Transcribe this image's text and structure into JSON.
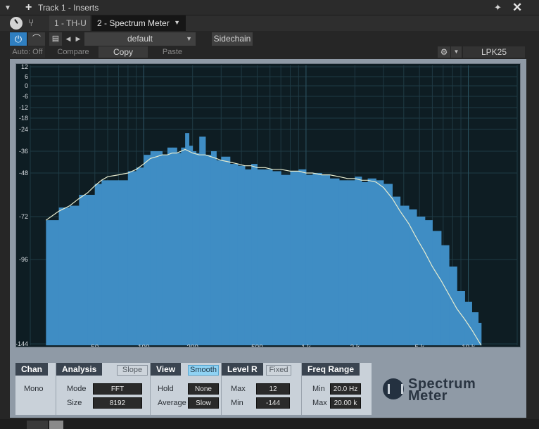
{
  "window": {
    "title": "Track 1 - Inserts"
  },
  "tabs": [
    {
      "label": "1 - TH-U"
    },
    {
      "label": "2 - Spectrum Meter"
    }
  ],
  "presets": {
    "name": "default",
    "sidechain_label": "Sidechain"
  },
  "toolbar": {
    "auto_label": "Auto: Off",
    "compare_label": "Compare",
    "copy_label": "Copy",
    "paste_label": "Paste",
    "device_label": "LPK25"
  },
  "chart_data": {
    "type": "area",
    "ytick_labels": [
      "12",
      "6",
      "0",
      "-6",
      "-12",
      "-18",
      "-24",
      "-36",
      "-48",
      "-72",
      "-96",
      "-144"
    ],
    "xtick_labels": [
      "50",
      "100",
      "200",
      "500",
      "1 k",
      "2 k",
      "5 k",
      "10 k"
    ],
    "xticks": [
      50,
      100,
      200,
      500,
      1000,
      2000,
      5000,
      10000
    ],
    "xlim": [
      20,
      20000
    ],
    "x_scale": "log",
    "y_scale": "nonlinear (dB meter)",
    "grid": true,
    "series": [
      {
        "style": "filled-bars",
        "color": "#3f8dc4",
        "x": [
          25,
          30,
          35,
          40,
          45,
          50,
          55,
          60,
          70,
          80,
          90,
          100,
          110,
          120,
          130,
          140,
          150,
          160,
          170,
          180,
          190,
          200,
          210,
          220,
          240,
          260,
          280,
          300,
          340,
          380,
          420,
          460,
          500,
          560,
          620,
          700,
          800,
          900,
          1000,
          1100,
          1250,
          1400,
          1600,
          1800,
          2000,
          2200,
          2400,
          2700,
          3000,
          3400,
          3800,
          4300,
          4800,
          5400,
          6000,
          6800,
          7600,
          8500,
          9500,
          10500,
          11500,
          12000
        ],
        "values": [
          -74,
          -67,
          -66,
          -60,
          -60,
          -54,
          -52,
          -52,
          -52,
          -47,
          -45,
          -38,
          -36,
          -36,
          -38,
          -34,
          -34,
          -37,
          -34,
          -26,
          -33,
          -36,
          -37,
          -28,
          -38,
          -36,
          -41,
          -39,
          -43,
          -44,
          -46,
          -43,
          -46,
          -46,
          -47,
          -49,
          -47,
          -46,
          -49,
          -48,
          -49,
          -51,
          -52,
          -52,
          -50,
          -53,
          -51,
          -52,
          -54,
          -61,
          -66,
          -68,
          -72,
          -74,
          -80,
          -88,
          -100,
          -114,
          -120,
          -126,
          -132,
          -150
        ]
      },
      {
        "style": "smoothed-line",
        "color": "#e8edd0",
        "x": [
          25,
          30,
          35,
          40,
          45,
          50,
          55,
          60,
          70,
          80,
          90,
          100,
          110,
          120,
          130,
          140,
          150,
          160,
          170,
          180,
          190,
          200,
          220,
          240,
          260,
          280,
          300,
          340,
          380,
          420,
          460,
          500,
          560,
          620,
          700,
          800,
          900,
          1000,
          1100,
          1250,
          1400,
          1600,
          1800,
          2000,
          2200,
          2400,
          2700,
          3000,
          3400,
          3800,
          4300,
          4800,
          5400,
          6000,
          6800,
          7600,
          8500,
          9500,
          10500,
          12000
        ],
        "values": [
          -74,
          -69,
          -66,
          -62,
          -59,
          -55,
          -52,
          -50,
          -49,
          -48,
          -46,
          -43,
          -40,
          -39,
          -38,
          -38,
          -37,
          -37,
          -36,
          -35,
          -36,
          -37,
          -38,
          -38,
          -39,
          -40,
          -41,
          -42,
          -43,
          -44,
          -44,
          -45,
          -45,
          -46,
          -46,
          -47,
          -47,
          -48,
          -48,
          -49,
          -49,
          -50,
          -51,
          -51,
          -52,
          -52,
          -53,
          -56,
          -62,
          -69,
          -76,
          -84,
          -92,
          -100,
          -108,
          -116,
          -124,
          -130,
          -136,
          -146
        ]
      }
    ]
  },
  "controls": {
    "chan": {
      "title": "Chan",
      "mode": "Mono"
    },
    "analysis": {
      "title": "Analysis",
      "slope_label": "Slope",
      "mode_label": "Mode",
      "mode_value": "FFT",
      "size_label": "Size",
      "size_value": "8192"
    },
    "view": {
      "title": "View",
      "smooth_label": "Smooth",
      "hold_label": "Hold",
      "hold_value": "None",
      "average_label": "Average",
      "average_value": "Slow"
    },
    "level": {
      "title": "Level R",
      "fixed_label": "Fixed",
      "max_label": "Max",
      "max_value": "12",
      "min_label": "Min",
      "min_value": "-144"
    },
    "freq": {
      "title": "Freq Range",
      "min_label": "Min",
      "min_value": "20.0 Hz",
      "max_label": "Max",
      "max_value": "20.00 k"
    }
  },
  "logo": {
    "line1": "Spectrum",
    "line2": "Meter"
  },
  "colors": {
    "accent": "#2f7fc1",
    "spectrum_fill": "#3f8dc4",
    "smoothed_line": "#e8edd0",
    "graph_bg": "#0e1d23",
    "smooth_on": "#8fd2f3"
  }
}
